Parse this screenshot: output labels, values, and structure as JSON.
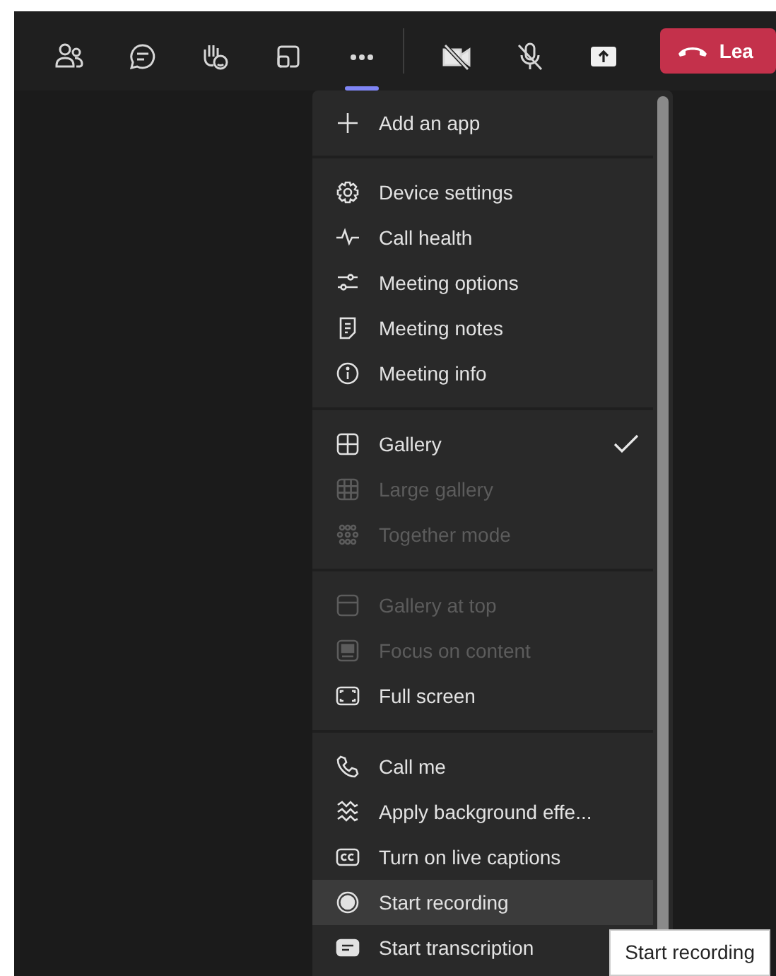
{
  "toolbar": {
    "left_buttons": [
      {
        "kind": "people",
        "selected": false
      },
      {
        "kind": "chat",
        "selected": false
      },
      {
        "kind": "react",
        "selected": false
      },
      {
        "kind": "rooms",
        "selected": false
      },
      {
        "kind": "more",
        "selected": true
      }
    ],
    "right_buttons": [
      {
        "kind": "camera-off",
        "selected": false
      },
      {
        "kind": "mic-off",
        "selected": false
      },
      {
        "kind": "share",
        "selected": false
      }
    ],
    "leave_button": {
      "label": "Lea"
    }
  },
  "menu": {
    "sections": [
      {
        "items": [
          {
            "kind": "plus",
            "label": "Add an app",
            "disabled": false,
            "checked": false,
            "highlighted": false
          }
        ]
      },
      {
        "items": [
          {
            "kind": "gear",
            "label": "Device settings",
            "disabled": false,
            "checked": false,
            "highlighted": false
          },
          {
            "kind": "pulse",
            "label": "Call health",
            "disabled": false,
            "checked": false,
            "highlighted": false
          },
          {
            "kind": "sliders",
            "label": "Meeting options",
            "disabled": false,
            "checked": false,
            "highlighted": false
          },
          {
            "kind": "notes",
            "label": "Meeting notes",
            "disabled": false,
            "checked": false,
            "highlighted": false
          },
          {
            "kind": "info",
            "label": "Meeting info",
            "disabled": false,
            "checked": false,
            "highlighted": false
          }
        ]
      },
      {
        "items": [
          {
            "kind": "grid4",
            "label": "Gallery",
            "disabled": false,
            "checked": true,
            "highlighted": false
          },
          {
            "kind": "grid9",
            "label": "Large gallery",
            "disabled": true,
            "checked": false,
            "highlighted": false
          },
          {
            "kind": "group",
            "label": "Together mode",
            "disabled": true,
            "checked": false,
            "highlighted": false
          }
        ]
      },
      {
        "items": [
          {
            "kind": "top",
            "label": "Gallery at top",
            "disabled": true,
            "checked": false,
            "highlighted": false
          },
          {
            "kind": "focus",
            "label": "Focus on content",
            "disabled": true,
            "checked": false,
            "highlighted": false
          },
          {
            "kind": "fullscreen",
            "label": "Full screen",
            "disabled": false,
            "checked": false,
            "highlighted": false
          }
        ]
      },
      {
        "items": [
          {
            "kind": "phone",
            "label": "Call me",
            "disabled": false,
            "checked": false,
            "highlighted": false
          },
          {
            "kind": "effects",
            "label": "Apply background effe...",
            "disabled": false,
            "checked": false,
            "highlighted": false
          },
          {
            "kind": "cc",
            "label": "Turn on live captions",
            "disabled": false,
            "checked": false,
            "highlighted": false
          },
          {
            "kind": "record",
            "label": "Start recording",
            "disabled": false,
            "checked": false,
            "highlighted": true
          },
          {
            "kind": "transcript",
            "label": "Start transcription",
            "disabled": false,
            "checked": false,
            "highlighted": false
          }
        ]
      }
    ]
  },
  "tooltip": {
    "text": "Start recording"
  }
}
